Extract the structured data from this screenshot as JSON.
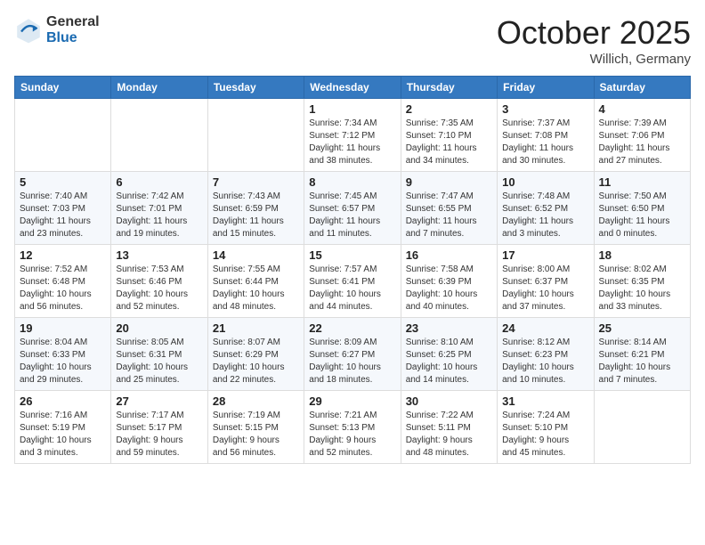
{
  "logo": {
    "general": "General",
    "blue": "Blue"
  },
  "header": {
    "month": "October 2025",
    "location": "Willich, Germany"
  },
  "weekdays": [
    "Sunday",
    "Monday",
    "Tuesday",
    "Wednesday",
    "Thursday",
    "Friday",
    "Saturday"
  ],
  "weeks": [
    [
      {
        "day": "",
        "info": ""
      },
      {
        "day": "",
        "info": ""
      },
      {
        "day": "",
        "info": ""
      },
      {
        "day": "1",
        "info": "Sunrise: 7:34 AM\nSunset: 7:12 PM\nDaylight: 11 hours\nand 38 minutes."
      },
      {
        "day": "2",
        "info": "Sunrise: 7:35 AM\nSunset: 7:10 PM\nDaylight: 11 hours\nand 34 minutes."
      },
      {
        "day": "3",
        "info": "Sunrise: 7:37 AM\nSunset: 7:08 PM\nDaylight: 11 hours\nand 30 minutes."
      },
      {
        "day": "4",
        "info": "Sunrise: 7:39 AM\nSunset: 7:06 PM\nDaylight: 11 hours\nand 27 minutes."
      }
    ],
    [
      {
        "day": "5",
        "info": "Sunrise: 7:40 AM\nSunset: 7:03 PM\nDaylight: 11 hours\nand 23 minutes."
      },
      {
        "day": "6",
        "info": "Sunrise: 7:42 AM\nSunset: 7:01 PM\nDaylight: 11 hours\nand 19 minutes."
      },
      {
        "day": "7",
        "info": "Sunrise: 7:43 AM\nSunset: 6:59 PM\nDaylight: 11 hours\nand 15 minutes."
      },
      {
        "day": "8",
        "info": "Sunrise: 7:45 AM\nSunset: 6:57 PM\nDaylight: 11 hours\nand 11 minutes."
      },
      {
        "day": "9",
        "info": "Sunrise: 7:47 AM\nSunset: 6:55 PM\nDaylight: 11 hours\nand 7 minutes."
      },
      {
        "day": "10",
        "info": "Sunrise: 7:48 AM\nSunset: 6:52 PM\nDaylight: 11 hours\nand 3 minutes."
      },
      {
        "day": "11",
        "info": "Sunrise: 7:50 AM\nSunset: 6:50 PM\nDaylight: 11 hours\nand 0 minutes."
      }
    ],
    [
      {
        "day": "12",
        "info": "Sunrise: 7:52 AM\nSunset: 6:48 PM\nDaylight: 10 hours\nand 56 minutes."
      },
      {
        "day": "13",
        "info": "Sunrise: 7:53 AM\nSunset: 6:46 PM\nDaylight: 10 hours\nand 52 minutes."
      },
      {
        "day": "14",
        "info": "Sunrise: 7:55 AM\nSunset: 6:44 PM\nDaylight: 10 hours\nand 48 minutes."
      },
      {
        "day": "15",
        "info": "Sunrise: 7:57 AM\nSunset: 6:41 PM\nDaylight: 10 hours\nand 44 minutes."
      },
      {
        "day": "16",
        "info": "Sunrise: 7:58 AM\nSunset: 6:39 PM\nDaylight: 10 hours\nand 40 minutes."
      },
      {
        "day": "17",
        "info": "Sunrise: 8:00 AM\nSunset: 6:37 PM\nDaylight: 10 hours\nand 37 minutes."
      },
      {
        "day": "18",
        "info": "Sunrise: 8:02 AM\nSunset: 6:35 PM\nDaylight: 10 hours\nand 33 minutes."
      }
    ],
    [
      {
        "day": "19",
        "info": "Sunrise: 8:04 AM\nSunset: 6:33 PM\nDaylight: 10 hours\nand 29 minutes."
      },
      {
        "day": "20",
        "info": "Sunrise: 8:05 AM\nSunset: 6:31 PM\nDaylight: 10 hours\nand 25 minutes."
      },
      {
        "day": "21",
        "info": "Sunrise: 8:07 AM\nSunset: 6:29 PM\nDaylight: 10 hours\nand 22 minutes."
      },
      {
        "day": "22",
        "info": "Sunrise: 8:09 AM\nSunset: 6:27 PM\nDaylight: 10 hours\nand 18 minutes."
      },
      {
        "day": "23",
        "info": "Sunrise: 8:10 AM\nSunset: 6:25 PM\nDaylight: 10 hours\nand 14 minutes."
      },
      {
        "day": "24",
        "info": "Sunrise: 8:12 AM\nSunset: 6:23 PM\nDaylight: 10 hours\nand 10 minutes."
      },
      {
        "day": "25",
        "info": "Sunrise: 8:14 AM\nSunset: 6:21 PM\nDaylight: 10 hours\nand 7 minutes."
      }
    ],
    [
      {
        "day": "26",
        "info": "Sunrise: 7:16 AM\nSunset: 5:19 PM\nDaylight: 10 hours\nand 3 minutes."
      },
      {
        "day": "27",
        "info": "Sunrise: 7:17 AM\nSunset: 5:17 PM\nDaylight: 9 hours\nand 59 minutes."
      },
      {
        "day": "28",
        "info": "Sunrise: 7:19 AM\nSunset: 5:15 PM\nDaylight: 9 hours\nand 56 minutes."
      },
      {
        "day": "29",
        "info": "Sunrise: 7:21 AM\nSunset: 5:13 PM\nDaylight: 9 hours\nand 52 minutes."
      },
      {
        "day": "30",
        "info": "Sunrise: 7:22 AM\nSunset: 5:11 PM\nDaylight: 9 hours\nand 48 minutes."
      },
      {
        "day": "31",
        "info": "Sunrise: 7:24 AM\nSunset: 5:10 PM\nDaylight: 9 hours\nand 45 minutes."
      },
      {
        "day": "",
        "info": ""
      }
    ]
  ]
}
